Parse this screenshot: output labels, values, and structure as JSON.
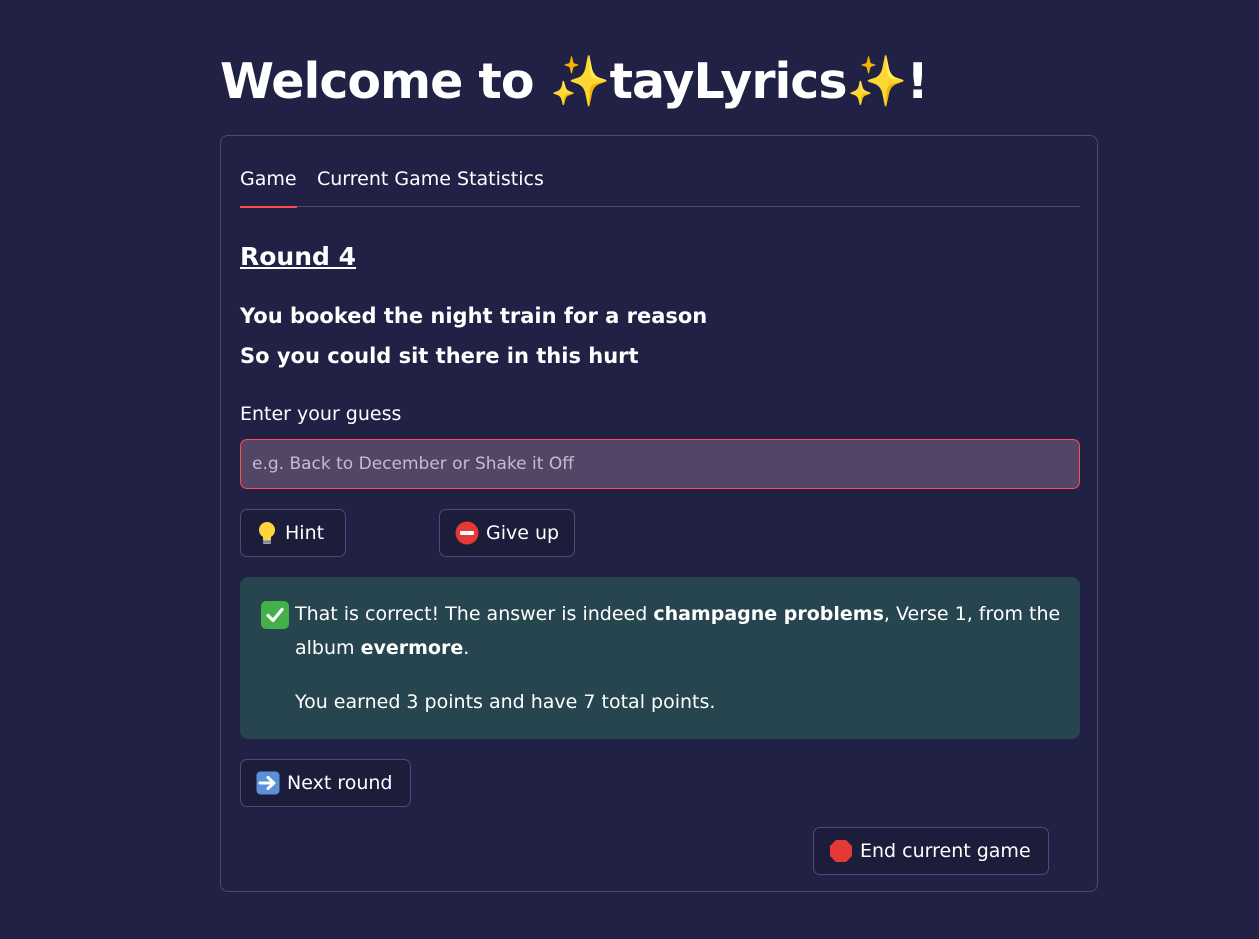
{
  "header": {
    "title_prefix": "Welcome to ",
    "sparkle": "✨",
    "brand": "tayLyrics",
    "title_suffix": "!"
  },
  "tabs": [
    {
      "label": "Game",
      "active": true
    },
    {
      "label": "Current Game Statistics",
      "active": false
    }
  ],
  "round": {
    "title": "Round 4"
  },
  "lyrics": [
    "You booked the night train for a reason",
    "So you could sit there in this hurt"
  ],
  "guess": {
    "label": "Enter your guess",
    "placeholder": "e.g. Back to December or Shake it Off",
    "value": ""
  },
  "buttons": {
    "hint_icon": "lightbulb-icon",
    "hint": "Hint",
    "give_up_icon": "no-entry-icon",
    "give_up": "Give up",
    "next_round_icon": "right-arrow-icon",
    "next_round": "Next round",
    "end_game_icon": "stop-sign-icon",
    "end_game": "End current game"
  },
  "result": {
    "icon": "check-mark-icon",
    "prefix": "That is correct! The answer is indeed ",
    "song": "champagne problems",
    "middle": ", Verse 1, from the album ",
    "album": "evermore",
    "suffix": ".",
    "points_line": "You earned 3 points and have 7 total points."
  },
  "colors": {
    "background": "#212146",
    "accent": "#ff4b4b",
    "success_bg": "#26454f",
    "input_bg": "#524565"
  }
}
